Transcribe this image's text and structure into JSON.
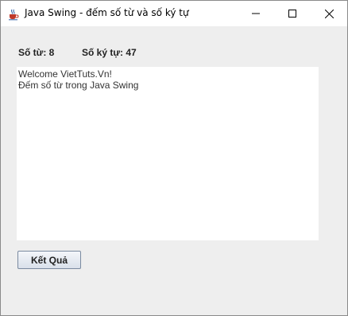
{
  "window": {
    "title": "Java Swing - đếm số từ và số ký tự"
  },
  "stats": {
    "word_count_label": "Số từ: 8",
    "char_count_label": "Số ký tự: 47"
  },
  "text_area": {
    "value": "Welcome VietTuts.Vn!\nĐếm số từ trong Java Swing"
  },
  "buttons": {
    "result_label": "Kết Quả"
  },
  "icons": {
    "app": "java-coffee-cup-icon",
    "minimize": "minimize-icon",
    "maximize": "maximize-icon",
    "close": "close-icon"
  }
}
